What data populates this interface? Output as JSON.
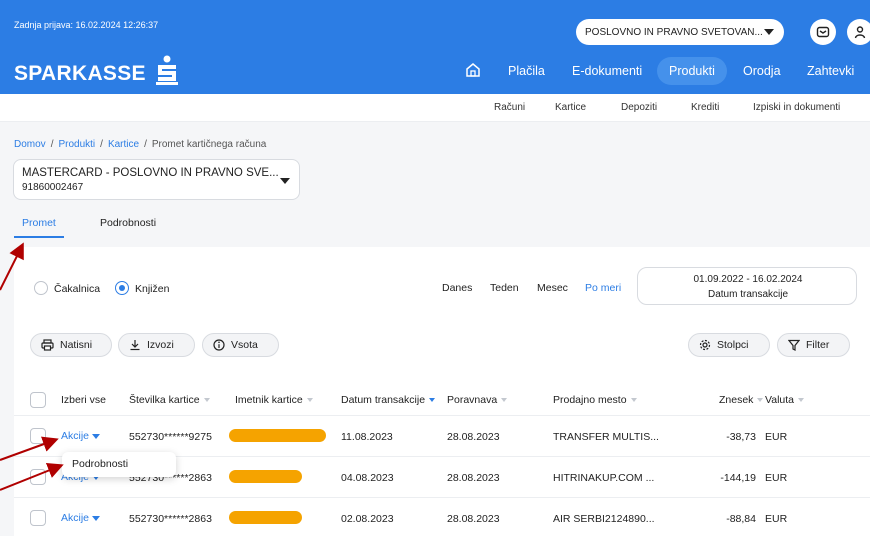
{
  "header": {
    "last_login": "Zadnja prijava: 16.02.2024 12:26:37",
    "company": "POSLOVNO IN PRAVNO SVETOVAN...",
    "logo_text": "SPARKASSE",
    "nav": [
      "Plačila",
      "E-dokumenti",
      "Produkti",
      "Orodja",
      "Zahtevki"
    ],
    "nav_active": "Produkti"
  },
  "subnav": [
    "Računi",
    "Kartice",
    "Depoziti",
    "Krediti",
    "Izpiski in dokumenti"
  ],
  "breadcrumb": [
    "Domov",
    "Produkti",
    "Kartice",
    "Promet kartičnega računa"
  ],
  "account": {
    "name": "MASTERCARD - POSLOVNO IN PRAVNO SVE...",
    "number": "91860002467"
  },
  "tabs": [
    "Promet",
    "Podrobnosti"
  ],
  "filters": {
    "status": [
      "Čakalnica",
      "Knjižen"
    ],
    "status_selected": "Knjižen",
    "periods": [
      "Danes",
      "Teden",
      "Mesec",
      "Po meri"
    ],
    "period_selected": "Po meri",
    "date_range": "01.09.2022 - 16.02.2024",
    "date_label": "Datum transakcije"
  },
  "actions": {
    "print": "Natisni",
    "export": "Izvozi",
    "sum": "Vsota",
    "columns": "Stolpci",
    "filter": "Filter"
  },
  "table": {
    "headers": [
      "Izberi vse",
      "Številka kartice",
      "Imetnik kartice",
      "Datum transakcije",
      "Poravnava",
      "Prodajno mesto",
      "Znesek",
      "Valuta"
    ],
    "action_label": "Akcije",
    "rows": [
      {
        "card": "552730******9275",
        "date": "11.08.2023",
        "settle": "28.08.2023",
        "merchant": "TRANSFER MULTIS...",
        "amount": "-38,73",
        "currency": "EUR"
      },
      {
        "card": "552730******2863",
        "date": "04.08.2023",
        "settle": "28.08.2023",
        "merchant": "HITRINAKUP.COM ...",
        "amount": "-144,19",
        "currency": "EUR"
      },
      {
        "card": "552730******2863",
        "date": "02.08.2023",
        "settle": "28.08.2023",
        "merchant": "AIR SERBI2124890...",
        "amount": "-88,84",
        "currency": "EUR"
      }
    ]
  },
  "dropdown": {
    "item": "Podrobnosti"
  },
  "colors": {
    "brand": "#2c7de4",
    "redaction": "#f5a300",
    "annotation_arrow": "#b00000"
  }
}
